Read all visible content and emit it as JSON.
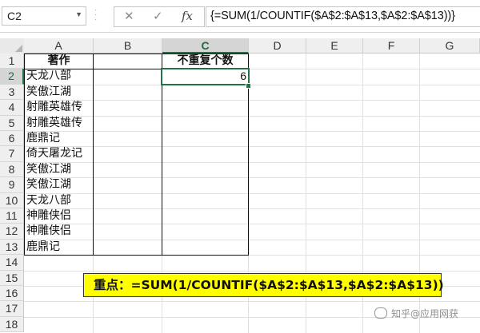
{
  "formula_bar": {
    "name_box": "C2",
    "cancel_icon": "✕",
    "enter_icon": "✓",
    "fx_label": "fx",
    "formula": "{=SUM(1/COUNTIF($A$2:$A$13,$A$2:$A$13))}"
  },
  "columns": [
    "A",
    "B",
    "C",
    "D",
    "E",
    "F",
    "G"
  ],
  "rows": [
    "1",
    "2",
    "3",
    "4",
    "5",
    "6",
    "7",
    "8",
    "9",
    "10",
    "11",
    "12",
    "13",
    "14",
    "15",
    "16",
    "17",
    "18"
  ],
  "sheet": {
    "A1": "著作",
    "C1": "不重复个数",
    "C2": "6",
    "A_values": [
      "天龙八部",
      "笑傲江湖",
      "射雕英雄传",
      "射雕英雄传",
      "鹿鼎记",
      "倚天屠龙记",
      "笑傲江湖",
      "笑傲江湖",
      "天龙八部",
      "神雕侠侣",
      "神雕侠侣",
      "鹿鼎记"
    ]
  },
  "callout": "重点：=SUM(1/COUNTIF($A$2:$A$13,$A$2:$A$13))",
  "watermark": "知乎@应用网获",
  "colors": {
    "accent": "#217346",
    "callout_bg": "#ffff00"
  }
}
